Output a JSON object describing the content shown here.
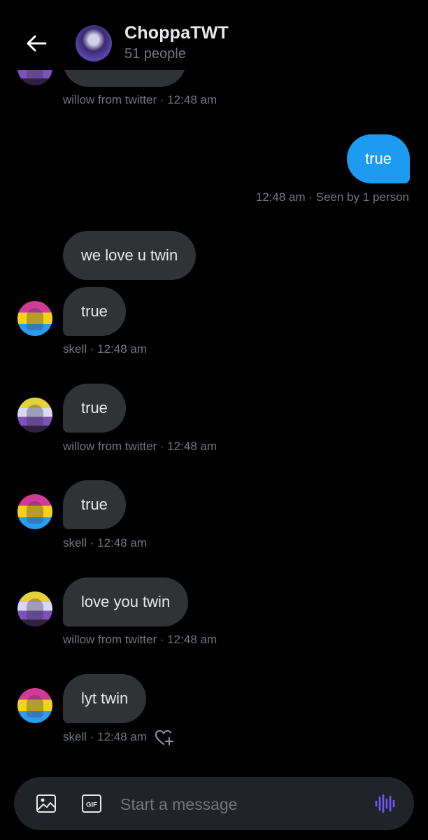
{
  "header": {
    "title": "ChoppaTWT",
    "subtitle": "51 people"
  },
  "messages": [
    {
      "sender": "willow from twitter",
      "text": "",
      "meta": "willow from twitter · 12:48 am"
    },
    {
      "sender": "me",
      "text": "true",
      "meta": "12:48 am · Seen by 1 person"
    },
    {
      "sender": "skell",
      "text": "we love u twin"
    },
    {
      "sender": "skell",
      "text": "true",
      "meta": "skell · 12:48 am"
    },
    {
      "sender": "willow from twitter",
      "text": "true",
      "meta": "willow from twitter · 12:48 am"
    },
    {
      "sender": "skell",
      "text": "true",
      "meta": "skell · 12:48 am"
    },
    {
      "sender": "willow from twitter",
      "text": "love you twin",
      "meta": "willow from twitter · 12:48 am"
    },
    {
      "sender": "skell",
      "text": "lyt twin",
      "meta": "skell · 12:48 am"
    }
  ],
  "composer": {
    "placeholder": "Start a message",
    "gif_label": "GIF"
  },
  "colors": {
    "background": "#000000",
    "bubble_received": "#2f3336",
    "bubble_sent": "#1d9bf0",
    "muted_text": "#71767b",
    "voice_accent": "#7856ff"
  },
  "icons": [
    "back-arrow-icon",
    "image-icon",
    "gif-icon",
    "voice-message-icon",
    "add-reaction-icon"
  ]
}
